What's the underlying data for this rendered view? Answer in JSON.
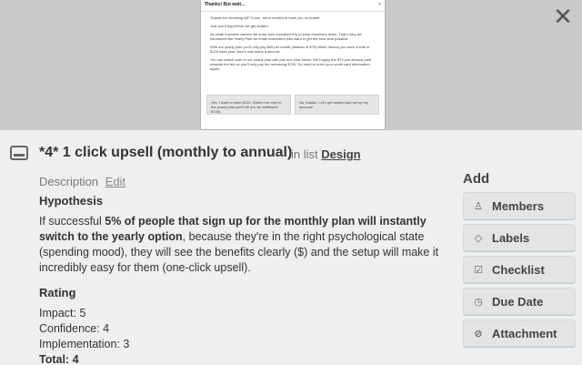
{
  "cover": {
    "modal_title": "Thanks! But wait...",
    "modal_close": "×",
    "para1": "Thanks for choosing WP Curve, we're excited to have you on board!",
    "para2": "Just one thing before we get started.",
    "para3": "As small business owners we know how important it is to keep expenses down. That's why we introduced the Yearly Plan for those customers who want to get the best deal possible.",
    "para4": "With our yearly plan you'll only pay $69 per month (instead of $79) which means you save a total of $120 each year. And it only takes a second.",
    "para5": "You can switch over to our yearly plan with just one click below. We'll apply the $79 you already paid towards the fee so you'll only pay the remaining $749. No need to enter your credit card information again.",
    "btn_yes": "Yes, I want to save $120. Switch me over to the yearly plan (we'll bill you an additional $749).",
    "btn_no": "No, thanks. Let's get started and set up my account!"
  },
  "close_glyph": "✕",
  "card": {
    "title": "*4* 1 click upsell (monthly to annual)",
    "in_list_prefix": "in list",
    "list_name": "Design"
  },
  "description": {
    "label": "Description",
    "edit": "Edit",
    "hypothesis_heading": "Hypothesis",
    "hyp_pre": "If successful ",
    "hyp_bold": "5% of people that sign up for the monthly plan will instantly switch to the yearly option",
    "hyp_post": ", because they're in the right psychological state (spending mood), they will see the benefits clearly ($) and the setup will make it incredibly easy for them (one-click upsell).",
    "rating_heading": "Rating",
    "impact": "Impact: 5",
    "confidence": "Confidence: 4",
    "implementation": "Implementation: 3",
    "total": "Total: 4"
  },
  "sidebar": {
    "add_title": "Add",
    "buttons": [
      {
        "label": "Members",
        "icon": "person-icon",
        "glyph": "♙"
      },
      {
        "label": "Labels",
        "icon": "tag-icon",
        "glyph": "◇"
      },
      {
        "label": "Checklist",
        "icon": "checkbox-icon",
        "glyph": "☑"
      },
      {
        "label": "Due Date",
        "icon": "clock-icon",
        "glyph": "◷"
      },
      {
        "label": "Attachment",
        "icon": "paperclip-icon",
        "glyph": "⊘"
      }
    ]
  }
}
